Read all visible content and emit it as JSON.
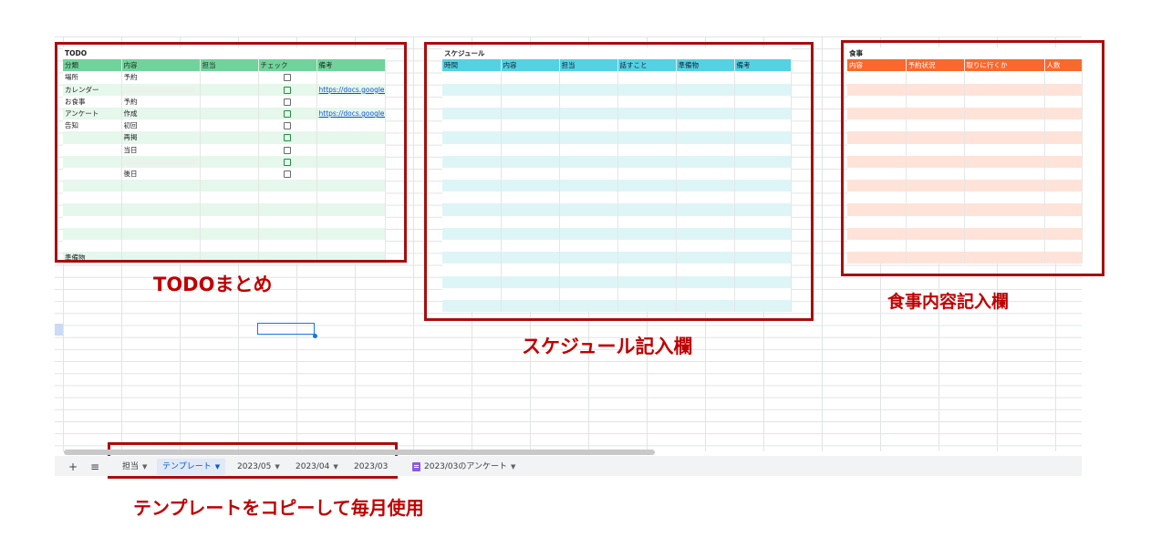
{
  "colors": {
    "annotation_red": "#c00000",
    "frame_red": "#a80d0d",
    "todo_header": "#6fd39b",
    "schedule_header": "#52d2e2",
    "meal_header": "#f9692b",
    "active_tab": "#0b57d0"
  },
  "todo": {
    "title": "TODO",
    "headers": [
      "分類",
      "内容",
      "担当",
      "チェック",
      "備考"
    ],
    "rows": [
      {
        "cat": "場所",
        "content": "予約",
        "check": true,
        "note": ""
      },
      {
        "cat": "カレンダー",
        "content": "",
        "check": true,
        "note": "https://docs.google."
      },
      {
        "cat": "お食事",
        "content": "予約",
        "check": true,
        "note": ""
      },
      {
        "cat": "アンケート",
        "content": "作成",
        "check": true,
        "note": "https://docs.google."
      },
      {
        "cat": "告知",
        "content": "初回",
        "check": true,
        "note": ""
      },
      {
        "cat": "",
        "content": "再掲",
        "check": true,
        "note": ""
      },
      {
        "cat": "",
        "content": "当日",
        "check": true,
        "note": ""
      },
      {
        "cat": "",
        "content": "",
        "check": true,
        "note": ""
      },
      {
        "cat": "",
        "content": "後日",
        "check": true,
        "note": ""
      }
    ],
    "footer": "準備物"
  },
  "schedule": {
    "title": "スケジュール",
    "headers": [
      "時間",
      "内容",
      "担当",
      "話すこと",
      "準備物",
      "備考"
    ]
  },
  "meal": {
    "title": "食事",
    "headers": [
      "内容",
      "予約状況",
      "取りに行くか",
      "人数"
    ]
  },
  "annotations": {
    "todo": "TODOまとめ",
    "schedule": "スケジュール記入欄",
    "meal": "食事内容記入欄",
    "tabs": "テンプレートをコピーして毎月使用"
  },
  "tabs": {
    "add_icon": "plus-icon",
    "menu_icon": "menu-icon",
    "items": [
      {
        "label": "担当",
        "active": false
      },
      {
        "label": "テンプレート",
        "active": true
      },
      {
        "label": "2023/05",
        "active": false
      },
      {
        "label": "2023/04",
        "active": false
      },
      {
        "label": "2023/03",
        "active": false
      },
      {
        "label": "2023/03のアンケート",
        "active": false,
        "icon": "form-icon"
      }
    ]
  }
}
